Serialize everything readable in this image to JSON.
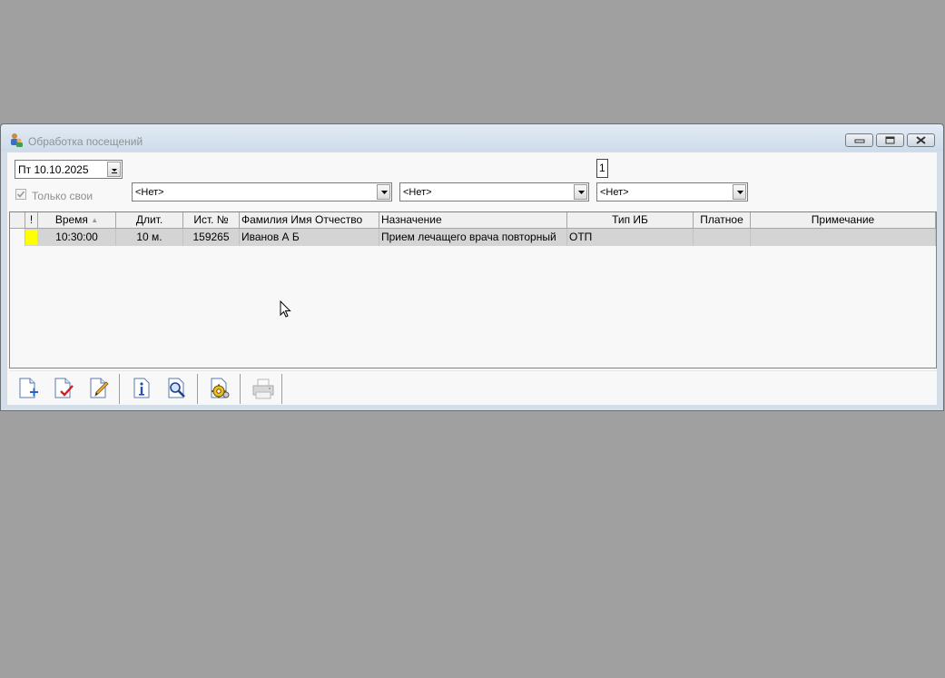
{
  "window": {
    "title": "Обработка посещений",
    "icons": [
      "app-icon",
      "minimize-icon",
      "maximize-icon",
      "close-icon"
    ]
  },
  "filters": {
    "date_value": "Пт  10.10.2025",
    "only_own_label": "Только свои",
    "only_own_checked": true,
    "combo1_value": "<Нет>",
    "combo2_value": "<Нет>",
    "combo3_value": "<Нет>",
    "count": "1"
  },
  "table": {
    "columns": [
      "",
      "!",
      "Время",
      "Длит.",
      "Ист. №",
      "Фамилия Имя Отчество",
      "Назначение",
      "Тип ИБ",
      "Платное",
      "Примечание"
    ],
    "rows": [
      {
        "flag_color": "#ffff00",
        "time": "10:30:00",
        "duration": "10 м.",
        "source_no": "159265",
        "fio": "Иванов А Б",
        "purpose": "Прием лечащего врача повторный",
        "type_ib": "ОТП",
        "paid": "",
        "note": ""
      }
    ]
  },
  "toolbar": {
    "icons": [
      "new-document-icon",
      "confirm-document-icon",
      "edit-document-icon",
      "info-icon",
      "search-icon",
      "settings-icon",
      "print-icon"
    ]
  }
}
